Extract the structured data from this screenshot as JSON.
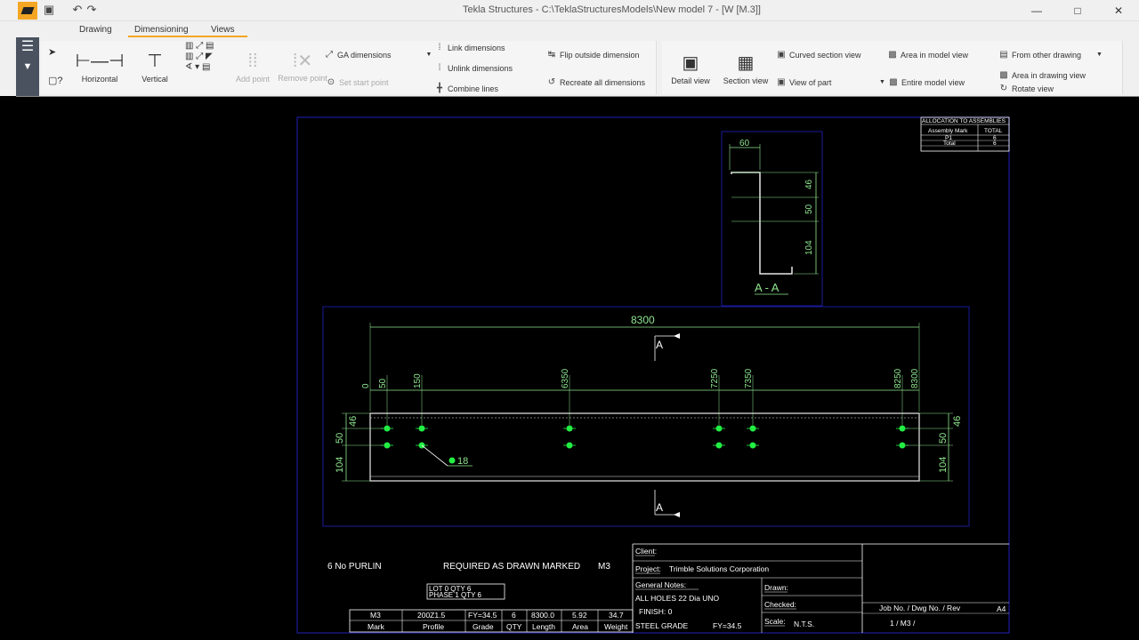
{
  "window": {
    "title": "Tekla Structures - C:\\TeklaStructuresModels\\New model 7  - [W  [M.3]]",
    "undo_icon": "undo-icon",
    "redo_icon": "redo-icon",
    "save_icon": "save-icon"
  },
  "ribbon": {
    "tabs": [
      {
        "label": "Drawing"
      },
      {
        "label": "Dimensioning"
      },
      {
        "label": "Views"
      }
    ],
    "dimension_buttons": [
      {
        "label": "Horizontal"
      },
      {
        "label": "Vertical"
      },
      {
        "label": "Add point"
      },
      {
        "label": "Remove point"
      }
    ],
    "ga_dimensions": "GA dimensions",
    "set_start_point": "Set start point",
    "link_dimensions": "Link dimensions",
    "unlink_dimensions": "Unlink dimensions",
    "combine_lines": "Combine lines",
    "flip_outside": "Flip outside dimension",
    "recreate_all": "Recreate all dimensions",
    "views": {
      "detail_view": "Detail view",
      "section_view": "Section view",
      "curved_section_view": "Curved section view",
      "view_of_part": "View of part",
      "area_in_model_view": "Area in model view",
      "entire_model_view": "Entire model view",
      "from_other_drawing": "From other drawing",
      "area_in_drawing_view": "Area in drawing view",
      "rotate_view": "Rotate view"
    }
  },
  "drawing": {
    "colors": {
      "frame": "#1a1a9a",
      "dim": "#8fe68f",
      "part": "#e8e8e8",
      "hole": "#22ee44"
    },
    "allocation": {
      "title": "ALLOCATION TO ASSEMBLIES",
      "headers": [
        "Assembly Mark",
        "TOTAL"
      ],
      "rows": [
        [
          "P1",
          "6"
        ],
        [
          "Total",
          "6"
        ]
      ]
    },
    "section": {
      "label": "A - A",
      "top_dim": "60",
      "right_dims": [
        "46",
        "50",
        "104"
      ]
    },
    "main_view": {
      "overall": "8300",
      "section_mark": "A",
      "top_dims": [
        "0",
        "50",
        "150",
        "6350",
        "7250",
        "7350",
        "8250",
        "8300"
      ],
      "left_dims": [
        "46",
        "50",
        "104"
      ],
      "right_dims": [
        "46",
        "50",
        "104"
      ],
      "hole_note": "18"
    },
    "notes": {
      "qty_line": "6  No   PURLIN",
      "required": "REQUIRED AS DRAWN MARKED",
      "mark": "M3",
      "lot": "LOT     0    QTY  6",
      "phase": "PHASE  1    QTY  6"
    },
    "bom": {
      "values": [
        "M3",
        "200Z1.5",
        "FY=34.5",
        "6",
        "8300.0",
        "5.92",
        "34.7"
      ],
      "headers": [
        "Mark",
        "Profile",
        "Grade",
        "QTY",
        "Length",
        "Area",
        "Weight"
      ]
    },
    "title_block": {
      "client": "Client:",
      "project_label": "Project:",
      "project": "Trimble Solutions Corporation",
      "general_notes": "General Notes:",
      "holes": "ALL HOLES 22   Dia UNO",
      "finish": "FINISH:   0",
      "steel": "STEEL GRADE",
      "fy": "FY=34.5",
      "drawn": "Drawn:",
      "checked": "Checked:",
      "scale_label": "Scale:",
      "scale": "N.T.S.",
      "job_header": "Job No.      /   Dwg No.   /   Rev",
      "job_values": "1         /        M3         /",
      "size": "A4"
    }
  }
}
